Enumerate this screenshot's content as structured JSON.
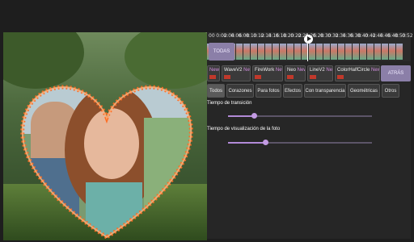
{
  "timeline": {
    "ticks": [
      "00",
      "0:02",
      "0:04",
      "0:06",
      "0:08",
      "0:10",
      "0:12",
      "0:14",
      "0:16",
      "0:18",
      "0:20",
      "0:22",
      "0:24",
      "0:26",
      "0:28",
      "0:30",
      "0:32",
      "0:34",
      "0:36",
      "0:38",
      "0:40",
      "0:42",
      "0:44",
      "0:46",
      "0:48",
      "0:50",
      "0:52"
    ],
    "todas_label": "TODAS"
  },
  "effects": [
    {
      "name": "",
      "new": "New"
    },
    {
      "name": "WaveV2",
      "new": "New"
    },
    {
      "name": "FireWork",
      "new": "New"
    },
    {
      "name": "Neo",
      "new": "New"
    },
    {
      "name": "LineV2",
      "new": "New"
    },
    {
      "name": "ColorHalfCircle",
      "new": "New"
    }
  ],
  "atras_label": "ATRÁS",
  "tabs": [
    "Todos",
    "Corazones",
    "Para fotos",
    "Efectos",
    "Con transparencia",
    "Geométricas",
    "Otros"
  ],
  "sliders": {
    "transition": {
      "label": "Tiempo de transición",
      "value": 0.18
    },
    "display": {
      "label": "Tiempo de visualización de la foto",
      "value": 0.26
    }
  }
}
